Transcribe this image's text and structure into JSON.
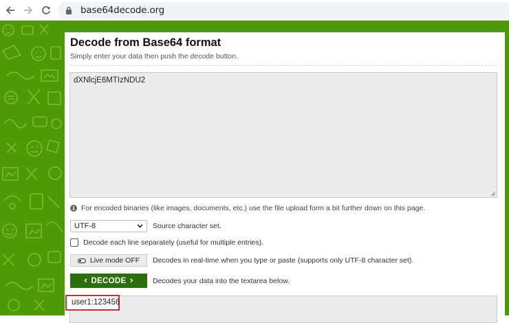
{
  "browser": {
    "url": "base64decode.org",
    "back_icon": "back-arrow-icon",
    "forward_icon": "forward-arrow-icon",
    "reload_icon": "reload-icon",
    "lock_icon": "lock-icon"
  },
  "page": {
    "title": "Decode from Base64 format",
    "subtitle": "Simply enter your data then push the decode button.",
    "input_value": "dXNlcjE6MTIzNDU2",
    "info_text": "For encoded binaries (like images, documents, etc.) use the file upload form a bit further down on this page.",
    "charset": {
      "selected": "UTF-8",
      "description": "Source character set."
    },
    "each_line": {
      "label": "Decode each line separately (useful for multiple entries).",
      "checked": false
    },
    "live_mode": {
      "label": "Live mode OFF",
      "description": "Decodes in real-time when you type or paste (supports only UTF-8 character set)."
    },
    "decode": {
      "label": "DECODE",
      "description": "Decodes your data into the textarea below."
    },
    "output_value": "user1:123456"
  },
  "colors": {
    "background_green": "#4e9a06",
    "decode_button": "#2c6e10",
    "highlight_border": "#d12a36"
  }
}
